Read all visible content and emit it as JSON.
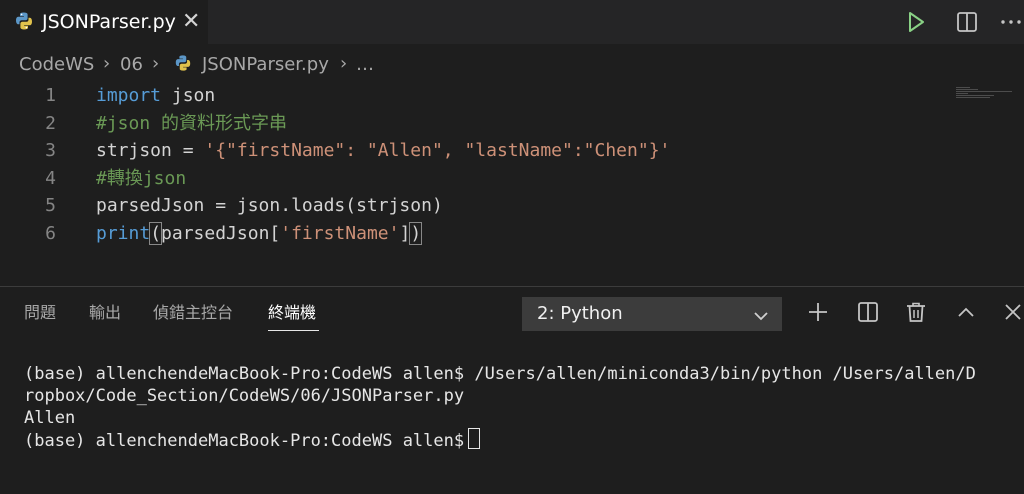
{
  "tab": {
    "title": "JSONParser.py",
    "close_glyph": "✕"
  },
  "toolbar": {
    "run_icon": "play-icon",
    "split_icon": "split-editor-icon",
    "more_icon": "more-actions-icon"
  },
  "breadcrumb": [
    "CodeWS",
    "06",
    "JSONParser.py",
    "…"
  ],
  "editor": {
    "line_numbers": [
      "1",
      "2",
      "3",
      "4",
      "5",
      "6"
    ],
    "lines": {
      "l1_kw": "import",
      "l1_rest": " json",
      "l2": "#json 的資料形式字串",
      "l3_a": "strjson = ",
      "l3_str": "'{\"firstName\": \"Allen\", \"lastName\":\"Chen\"}'",
      "l4": "#轉換json",
      "l5": "parsedJson = json.loads(strjson)",
      "l6_kw": "print",
      "l6_open": "(",
      "l6_a": "parsedJson[",
      "l6_str": "'firstName'",
      "l6_b": "]",
      "l6_close": ")"
    }
  },
  "panel": {
    "tabs": [
      "問題",
      "輸出",
      "偵錯主控台",
      "終端機"
    ],
    "active_tab": "終端機",
    "terminal_select": "2: Python",
    "icons": [
      "add-icon",
      "split-terminal-icon",
      "trash-icon",
      "chevron-up-icon",
      "close-icon"
    ]
  },
  "terminal": {
    "lines": [
      "(base) allenchendeMacBook-Pro:CodeWS allen$ /Users/allen/miniconda3/bin/python /Users/allen/D",
      "ropbox/Code_Section/CodeWS/06/JSONParser.py",
      "Allen",
      "(base) allenchendeMacBook-Pro:CodeWS allen$"
    ]
  },
  "colors": {
    "background": "#1e1e1e",
    "keyword": "#569cd6",
    "comment": "#6a9955",
    "string": "#ce9178",
    "run": "#89d185"
  }
}
